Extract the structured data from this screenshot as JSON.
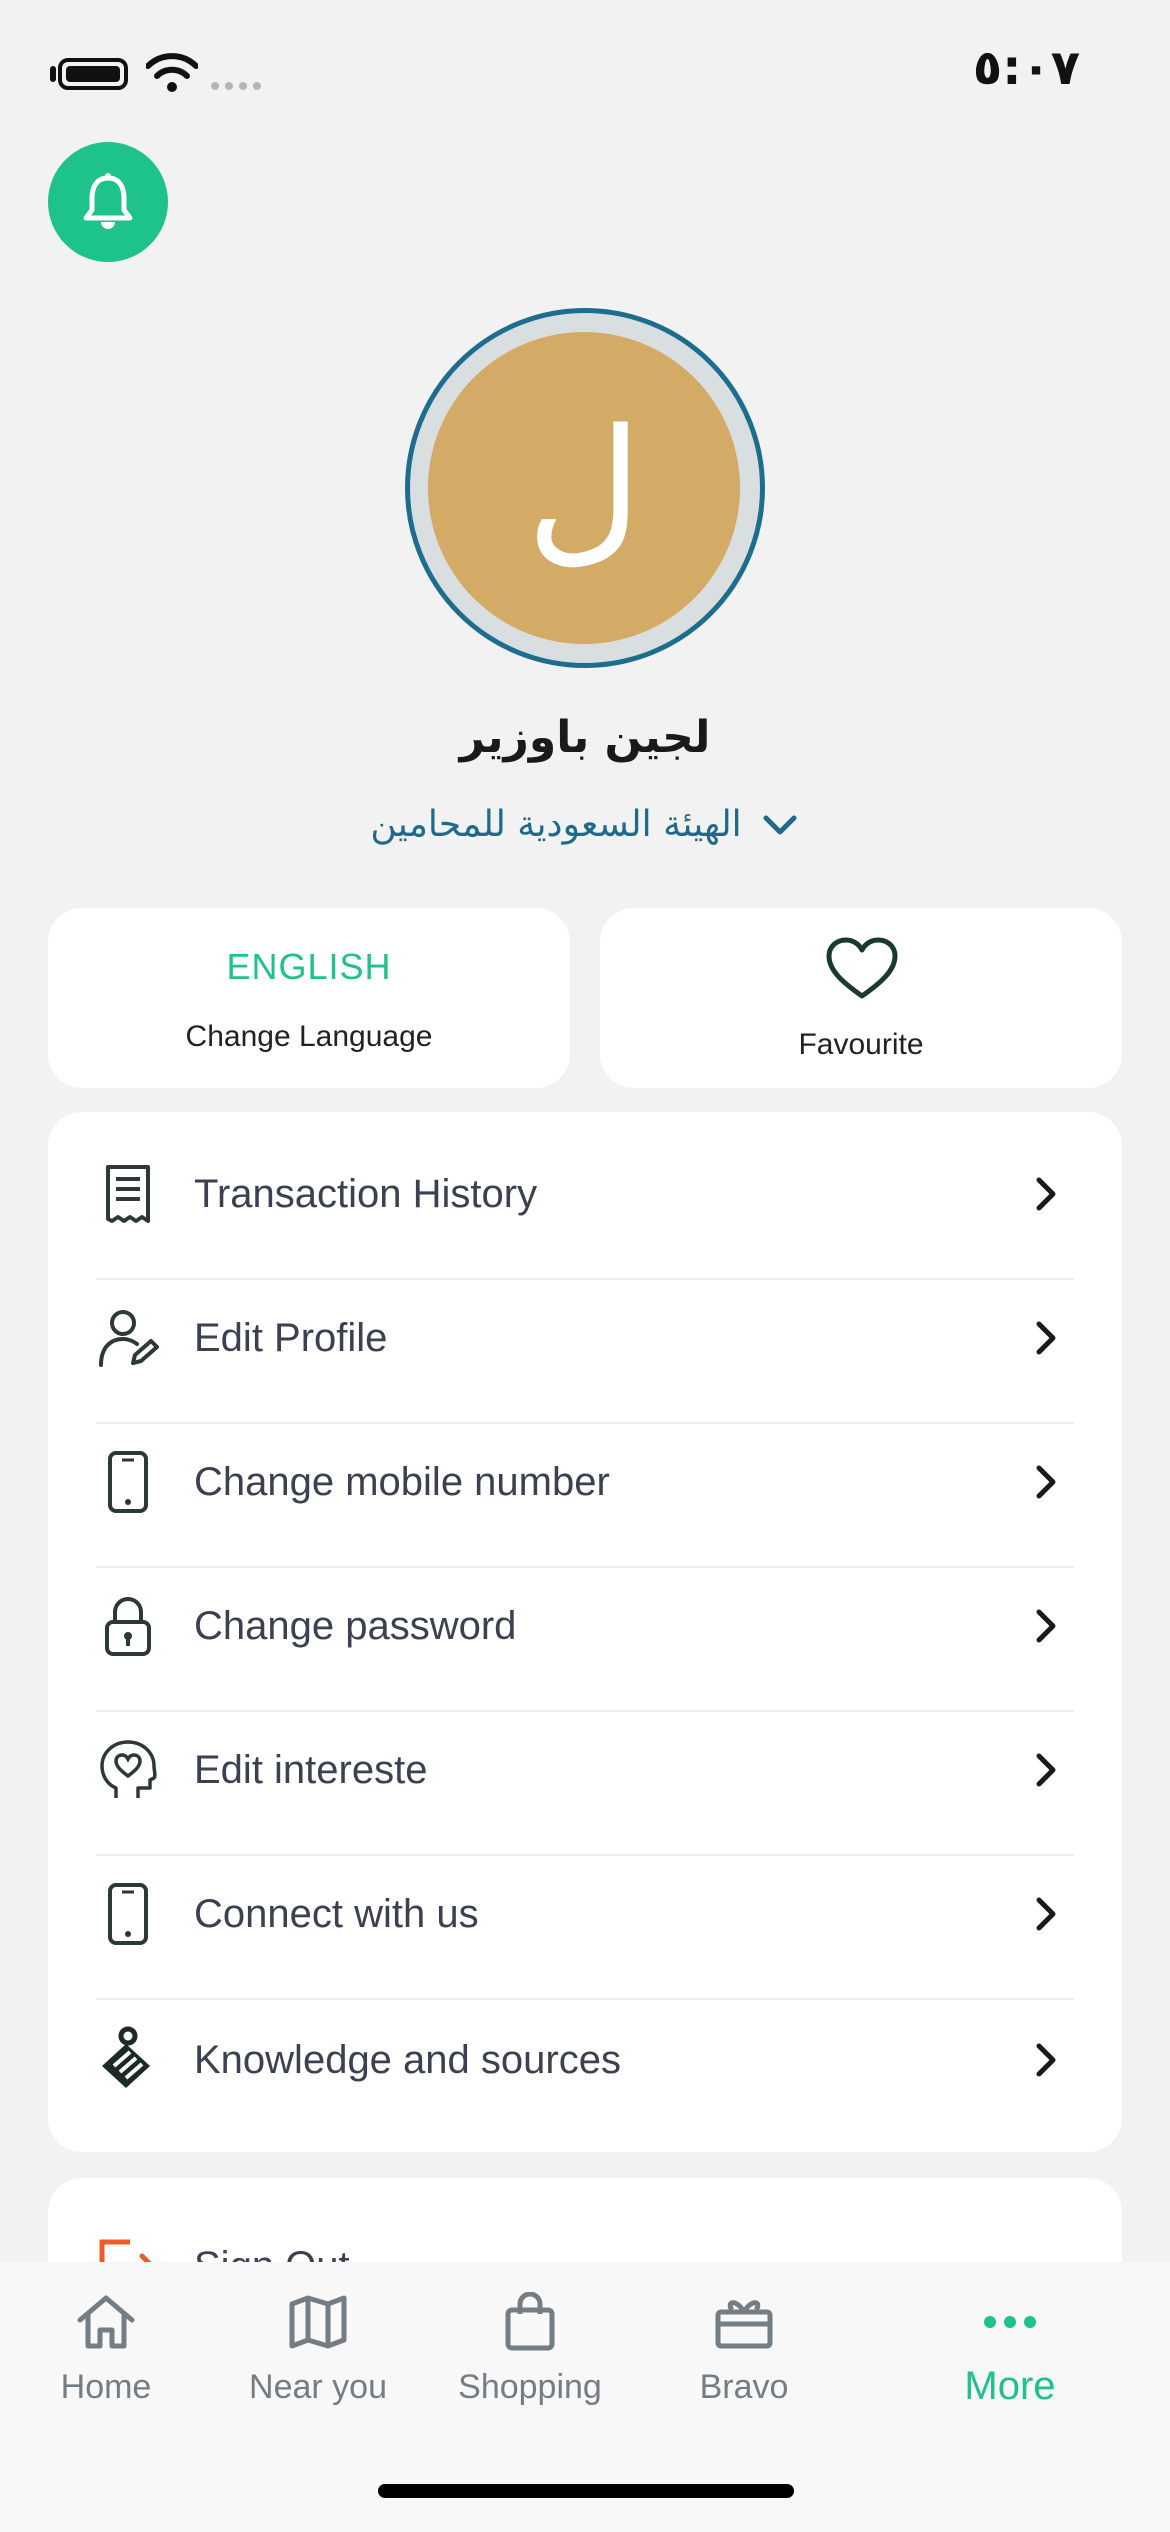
{
  "status_bar": {
    "time": "٥:٠٧"
  },
  "profile": {
    "initial": "ل",
    "name": "لجين باوزير",
    "organization": "الهيئة السعودية للمحامين"
  },
  "cards": {
    "language_code": "ENGLISH",
    "language_label": "Change Language",
    "favourite_label": "Favourite"
  },
  "menu": [
    {
      "label": "Transaction History",
      "icon": "receipt-icon"
    },
    {
      "label": "Edit Profile",
      "icon": "user-edit-icon"
    },
    {
      "label": "Change mobile number",
      "icon": "phone-icon"
    },
    {
      "label": "Change password",
      "icon": "lock-icon"
    },
    {
      "label": "Edit intereste",
      "icon": "head-heart-icon"
    },
    {
      "label": "Connect with us",
      "icon": "phone-icon"
    },
    {
      "label": "Knowledge and sources",
      "icon": "knowledge-icon"
    }
  ],
  "sign_out": {
    "label": "Sign Out",
    "icon": "logout-icon"
  },
  "tabbar": {
    "items": [
      {
        "label": "Home",
        "icon": "home-icon"
      },
      {
        "label": "Near you",
        "icon": "map-icon"
      },
      {
        "label": "Shopping",
        "icon": "bag-icon"
      },
      {
        "label": "Bravo",
        "icon": "gift-icon"
      },
      {
        "label": "More",
        "icon": "more-icon"
      }
    ],
    "active": "More"
  },
  "colors": {
    "accent": "#1ec28b",
    "avatar_bg": "#d3ab67",
    "avatar_ring": "#1d6e8e",
    "org_text": "#1e6a8b",
    "signout_icon": "#f05a28"
  }
}
